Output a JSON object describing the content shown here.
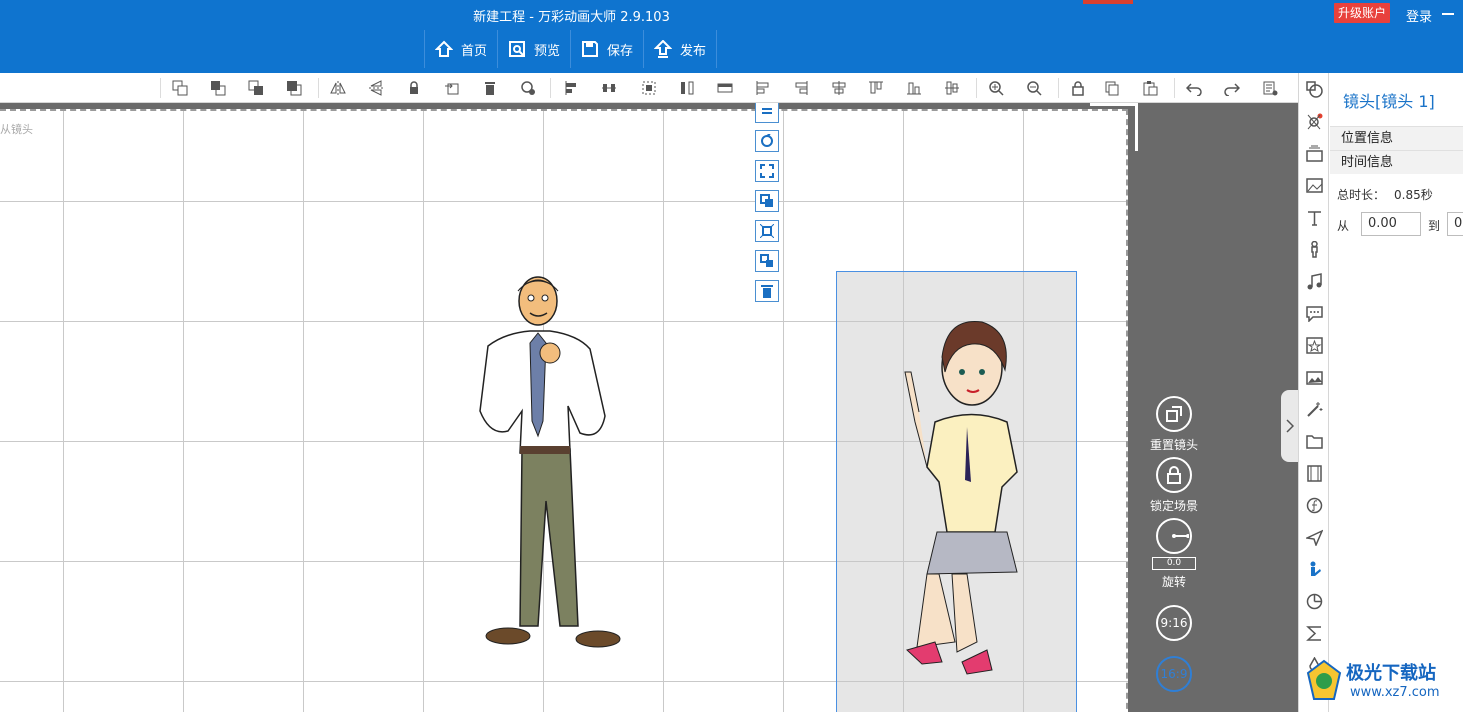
{
  "app": {
    "window_title": "新建工程 - 万彩动画大师 2.9.103",
    "upgrade_label": "升级账户",
    "login_label": "登录"
  },
  "main_menu": [
    {
      "label": "首页",
      "icon": "home-icon"
    },
    {
      "label": "预览",
      "icon": "preview-icon"
    },
    {
      "label": "保存",
      "icon": "save-icon"
    },
    {
      "label": "发布",
      "icon": "publish-icon"
    }
  ],
  "canvas": {
    "shot_label": "从镜头",
    "controls": {
      "reset_camera": "重置镜头",
      "lock_scene": "锁定场景",
      "rotate": "旋转",
      "rotate_value": "0.0",
      "ratio_portrait": "9:16",
      "ratio_landscape": "16:9"
    }
  },
  "panel": {
    "title": "镜头[镜头 1]",
    "section_position": "位置信息",
    "section_time": "时间信息",
    "total_duration_label": "总时长：",
    "total_duration_value": "0.85秒",
    "from_label": "从",
    "from_value": "0.00",
    "to_label": "到",
    "to_value": "0"
  },
  "watermark": {
    "title": "极光下载站",
    "url": "www.xz7.com"
  },
  "colors": {
    "titlebar": "#0f74cf",
    "accent": "#1a73c8",
    "canvas_bg": "#6a6a6a",
    "upgrade": "#e8413c"
  }
}
